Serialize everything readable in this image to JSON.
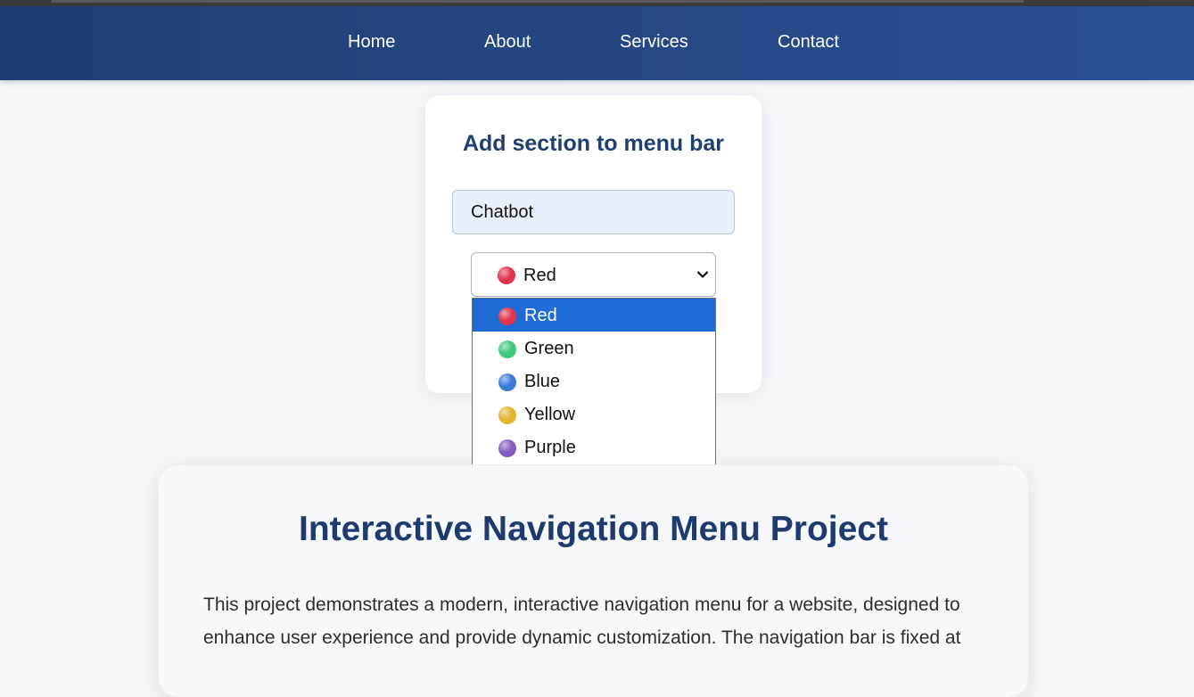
{
  "nav": {
    "links": [
      "Home",
      "About",
      "Services",
      "Contact"
    ],
    "background": "#264a86"
  },
  "form": {
    "title": "Add section to menu bar",
    "input_value": "Chatbot",
    "select": {
      "selected": "Red",
      "selected_color": "#e0344f",
      "options": [
        {
          "label": "Red",
          "color": "#e0344f"
        },
        {
          "label": "Green",
          "color": "#3fc77c"
        },
        {
          "label": "Blue",
          "color": "#3a7ad9"
        },
        {
          "label": "Yellow",
          "color": "#e3b52f"
        },
        {
          "label": "Purple",
          "color": "#8658c2"
        }
      ],
      "highlight_color": "#1e6bd6"
    }
  },
  "info": {
    "title": "Interactive Navigation Menu Project",
    "paragraph_line1": "This project demonstrates a modern, interactive navigation menu for a website, designed to",
    "paragraph_line2": "enhance user experience and provide dynamic customization. The navigation bar is fixed at"
  }
}
